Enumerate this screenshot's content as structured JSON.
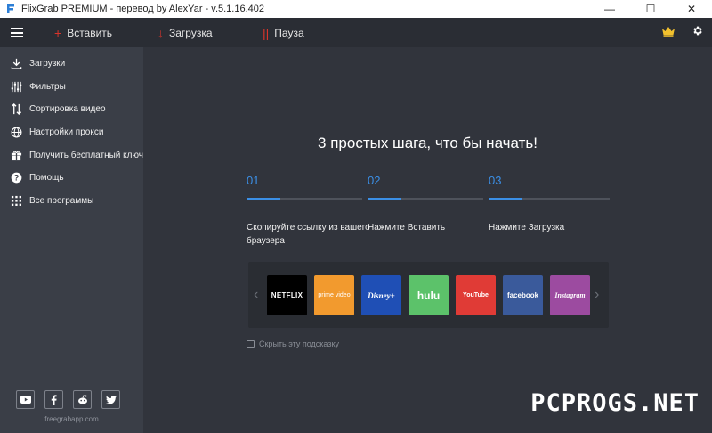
{
  "window": {
    "title": "FlixGrab PREMIUM - перевод by AlexYar - v.5.1.16.402",
    "minimize": "—",
    "maximize": "☐",
    "close": "✕"
  },
  "toolbar": {
    "paste_label": "Вставить",
    "download_label": "Загрузка",
    "pause_label": "Пауза",
    "paste_icon": "plus-icon",
    "download_icon": "arrow-down-icon",
    "pause_icon": "pause-icon",
    "accent": "#d9342b",
    "crown_color": "#f2c12e"
  },
  "sidebar": {
    "items": [
      {
        "label": "Загрузки",
        "icon": "download-icon"
      },
      {
        "label": "Фильтры",
        "icon": "filter-sliders-icon"
      },
      {
        "label": "Сортировка видео",
        "icon": "sort-icon"
      },
      {
        "label": "Настройки прокси",
        "icon": "globe-icon"
      },
      {
        "label": "Получить бесплатный ключ",
        "icon": "gift-icon"
      },
      {
        "label": "Помощь",
        "icon": "help-icon"
      },
      {
        "label": "Все программы",
        "icon": "grid-icon"
      }
    ],
    "social": [
      "youtube-icon",
      "facebook-icon",
      "reddit-icon",
      "twitter-icon"
    ],
    "site": "freegrabapp.com"
  },
  "main": {
    "headline": "3 простых шага, что бы начать!",
    "steps": [
      {
        "num": "01",
        "desc": "Скопируйте ссылку из вашего браузера"
      },
      {
        "num": "02",
        "desc": "Нажмите Вставить"
      },
      {
        "num": "03",
        "desc": "Нажмите Загрузка"
      }
    ],
    "accent": "#3b8fe6",
    "services": [
      {
        "name": "NETFLIX",
        "color": "#000000"
      },
      {
        "name": "prime video",
        "color": "#f29a2e"
      },
      {
        "name": "Disney+",
        "color": "#1f4fb5"
      },
      {
        "name": "hulu",
        "color": "#5cc26a"
      },
      {
        "name": "YouTube",
        "color": "#e03b36"
      },
      {
        "name": "facebook",
        "color": "#3a5a9b"
      },
      {
        "name": "Instagram",
        "color": "#9c4ba0"
      }
    ],
    "hint": "Скрыть эту подсказку"
  },
  "watermark": "PCPROGS.NET"
}
